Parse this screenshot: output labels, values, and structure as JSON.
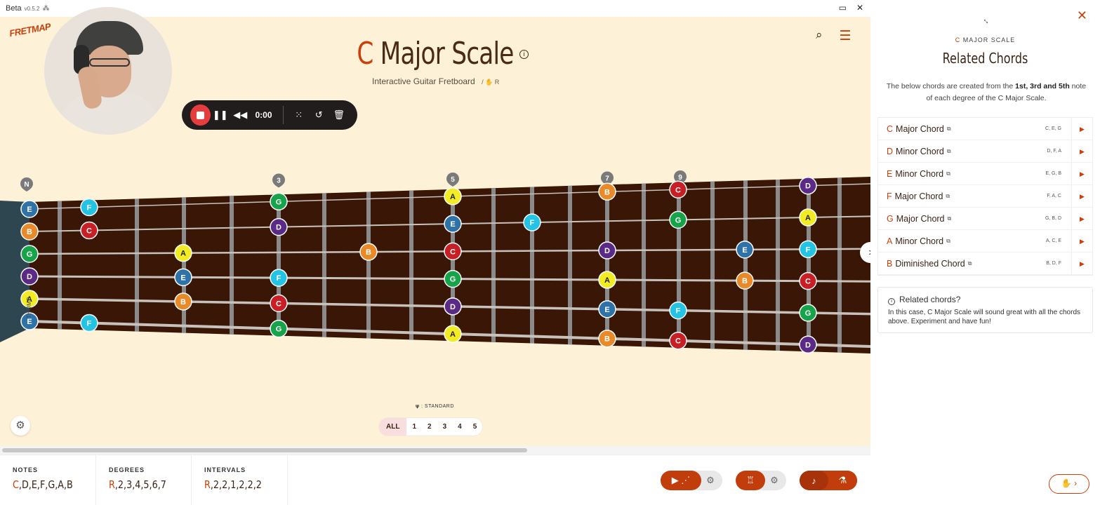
{
  "app": {
    "name": "Beta",
    "version": "v0.5.2"
  },
  "header": {
    "title_root": "C",
    "title_rest": "Major Scale",
    "subtitle": "Interactive Guitar Fretboard",
    "subtitle_extra": "/ ✋ R"
  },
  "recorder": {
    "time": "0:00"
  },
  "fret_markers": [
    "N",
    "3",
    "5",
    "7",
    "9"
  ],
  "thumb_label": "THUMB",
  "tuning_label": "𝛙 : STANDARD",
  "positions": [
    "ALL",
    "1",
    "2",
    "3",
    "4",
    "5"
  ],
  "note_colors": {
    "C": "#c81e25",
    "D": "#5a2a86",
    "E": "#2f72a8",
    "F": "#24c3e3",
    "G": "#16a34a",
    "A": "#f2ec24",
    "B": "#e98a2a"
  },
  "bottom": {
    "notes_label": "NOTES",
    "notes_root": "C",
    "notes_rest": ",D,E,F,G,A,B",
    "degrees_label": "DEGREES",
    "degrees_root": "R",
    "degrees_rest": ",2,3,4,5,6,7",
    "intervals_label": "INTERVALS",
    "intervals_root": "R",
    "intervals_rest": ",2,2,1,2,2,2"
  },
  "sidebar": {
    "subtitle_root": "C",
    "subtitle_rest": "MAJOR SCALE",
    "title": "Related Chords",
    "desc_a": "The below chords are created from the ",
    "desc_b": "1st, 3rd and 5th",
    "desc_c": " note of each degree of the C Major Scale.",
    "chords": [
      {
        "root": "C",
        "name": "Major Chord",
        "notes": "C, E, G"
      },
      {
        "root": "D",
        "name": "Minor Chord",
        "notes": "D, F, A"
      },
      {
        "root": "E",
        "name": "Minor Chord",
        "notes": "E, G, B"
      },
      {
        "root": "F",
        "name": "Major Chord",
        "notes": "F, A, C"
      },
      {
        "root": "G",
        "name": "Major Chord",
        "notes": "G, B, D"
      },
      {
        "root": "A",
        "name": "Minor Chord",
        "notes": "A, C, E"
      },
      {
        "root": "B",
        "name": "Diminished Chord",
        "notes": "B, D, F"
      }
    ],
    "callout_title": "Related chords?",
    "callout_body": "In this case, C Major Scale will sound great with all the chords above. Experiment and have fun!"
  },
  "fretboard": {
    "strings": [
      "E",
      "B",
      "G",
      "D",
      "A",
      "E"
    ],
    "open_notes": [
      "E",
      "B",
      "G",
      "D",
      "A",
      "E"
    ],
    "dots": [
      {
        "fret": 1,
        "string": 0,
        "note": "F"
      },
      {
        "fret": 1,
        "string": 1,
        "note": "C"
      },
      {
        "fret": 1,
        "string": 5,
        "note": "F"
      },
      {
        "fret": 2,
        "string": 2,
        "note": "A"
      },
      {
        "fret": 2,
        "string": 3,
        "note": "E"
      },
      {
        "fret": 2,
        "string": 4,
        "note": "B"
      },
      {
        "fret": 3,
        "string": 0,
        "note": "G"
      },
      {
        "fret": 3,
        "string": 1,
        "note": "D"
      },
      {
        "fret": 3,
        "string": 3,
        "note": "F"
      },
      {
        "fret": 3,
        "string": 4,
        "note": "C"
      },
      {
        "fret": 3,
        "string": 5,
        "note": "G"
      },
      {
        "fret": 4,
        "string": 2,
        "note": "B"
      },
      {
        "fret": 5,
        "string": 0,
        "note": "A"
      },
      {
        "fret": 5,
        "string": 1,
        "note": "E"
      },
      {
        "fret": 5,
        "string": 2,
        "note": "C"
      },
      {
        "fret": 5,
        "string": 3,
        "note": "G"
      },
      {
        "fret": 5,
        "string": 4,
        "note": "D"
      },
      {
        "fret": 5,
        "string": 5,
        "note": "A"
      },
      {
        "fret": 6,
        "string": 1,
        "note": "F"
      },
      {
        "fret": 7,
        "string": 0,
        "note": "B"
      },
      {
        "fret": 7,
        "string": 2,
        "note": "D"
      },
      {
        "fret": 7,
        "string": 3,
        "note": "A"
      },
      {
        "fret": 7,
        "string": 4,
        "note": "E"
      },
      {
        "fret": 7,
        "string": 5,
        "note": "B"
      },
      {
        "fret": 8,
        "string": 0,
        "note": "C"
      },
      {
        "fret": 8,
        "string": 1,
        "note": "G"
      },
      {
        "fret": 8,
        "string": 4,
        "note": "F"
      },
      {
        "fret": 8,
        "string": 5,
        "note": "C"
      },
      {
        "fret": 9,
        "string": 2,
        "note": "E"
      },
      {
        "fret": 9,
        "string": 3,
        "note": "B"
      },
      {
        "fret": 10,
        "string": 0,
        "note": "D"
      },
      {
        "fret": 10,
        "string": 1,
        "note": "A"
      },
      {
        "fret": 10,
        "string": 2,
        "note": "F"
      },
      {
        "fret": 10,
        "string": 3,
        "note": "C"
      },
      {
        "fret": 10,
        "string": 4,
        "note": "G"
      },
      {
        "fret": 10,
        "string": 5,
        "note": "D"
      }
    ]
  }
}
